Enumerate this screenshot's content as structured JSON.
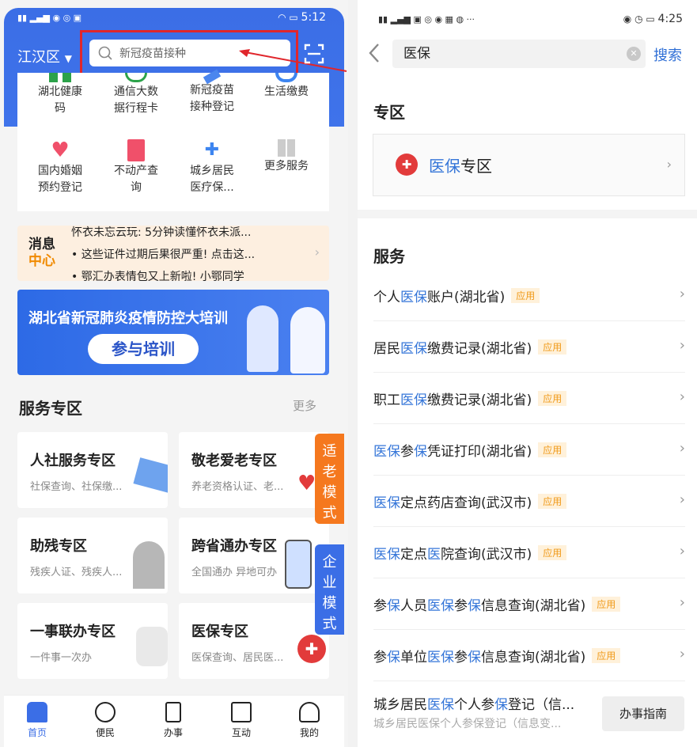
{
  "left": {
    "status": {
      "time": "5:12"
    },
    "city": "江汉区",
    "search": {
      "placeholder": "新冠疫苗接种"
    },
    "grid": [
      {
        "l1": "湖北健康",
        "l2": "码"
      },
      {
        "l1": "通信大数",
        "l2": "据行程卡"
      },
      {
        "l1": "新冠疫苗",
        "l2": "接种登记"
      },
      {
        "l1": "生活缴费",
        "l2": ""
      },
      {
        "l1": "国内婚姻",
        "l2": "预约登记"
      },
      {
        "l1": "不动产查",
        "l2": "询"
      },
      {
        "l1": "城乡居民",
        "l2": "医疗保..."
      },
      {
        "l1": "更多服务",
        "l2": ""
      }
    ],
    "msg": {
      "tag1": "消息",
      "tag2": "中心",
      "lines": [
        "怀衣未忘云玩: 5分钟读懂怀衣未派...",
        "• 这些证件过期后果很严重! 点击这...",
        "• 鄂汇办表情包又上新啦! 小鄂同学"
      ]
    },
    "banner": {
      "title": "湖北省新冠肺炎疫情防控大培训",
      "button": "参与培训"
    },
    "section": {
      "title": "服务专区",
      "more": "更多"
    },
    "tiles": [
      {
        "title": "人社服务专区",
        "sub": "社保查询、社保缴..."
      },
      {
        "title": "敬老爱老专区",
        "sub": "养老资格认证、老..."
      },
      {
        "title": "助残专区",
        "sub": "残疾人证、残疾人..."
      },
      {
        "title": "跨省通办专区",
        "sub": "全国通办  异地可办"
      },
      {
        "title": "一事联办专区",
        "sub": "一件事一次办"
      },
      {
        "title": "医保专区",
        "sub": "医保查询、居民医..."
      }
    ],
    "side_tabs": [
      "适老模式",
      "企业模式"
    ],
    "nav": [
      "首页",
      "便民",
      "办事",
      "互动",
      "我的"
    ]
  },
  "right": {
    "status": {
      "time": "4:25"
    },
    "search": {
      "value": "医保",
      "button": "搜索"
    },
    "zone": {
      "title": "专区",
      "item_hl": "医保",
      "item_rest": "专区"
    },
    "services": {
      "title": "服务",
      "badge": "应用",
      "rows": [
        [
          [
            "个人",
            0
          ],
          [
            "医保",
            1
          ],
          [
            "账户(湖北省)",
            0
          ]
        ],
        [
          [
            "居民",
            0
          ],
          [
            "医保",
            1
          ],
          [
            "缴费记录(湖北省)",
            0
          ]
        ],
        [
          [
            "职工",
            0
          ],
          [
            "医保",
            1
          ],
          [
            "缴费记录(湖北省)",
            0
          ]
        ],
        [
          [
            "医保",
            1
          ],
          [
            "参",
            0
          ],
          [
            "保",
            1
          ],
          [
            "凭证打印(湖北省)",
            0
          ]
        ],
        [
          [
            "医保",
            1
          ],
          [
            "定点药店查询(武汉市)",
            0
          ]
        ],
        [
          [
            "医保",
            1
          ],
          [
            "定点",
            0
          ],
          [
            "医",
            1
          ],
          [
            "院查询(武汉市)",
            0
          ]
        ],
        [
          [
            "参",
            0
          ],
          [
            "保",
            1
          ],
          [
            "人员",
            0
          ],
          [
            "医保",
            1
          ],
          [
            "参",
            0
          ],
          [
            "保",
            1
          ],
          [
            "信息查询(湖北省)",
            0
          ]
        ],
        [
          [
            "参",
            0
          ],
          [
            "保",
            1
          ],
          [
            "单位",
            0
          ],
          [
            "医保",
            1
          ],
          [
            "参",
            0
          ],
          [
            "保",
            1
          ],
          [
            "信息查询(湖北省)",
            0
          ]
        ]
      ],
      "last": {
        "title_parts": [
          [
            "城乡居民",
            0
          ],
          [
            "医保",
            1
          ],
          [
            "个人参",
            0
          ],
          [
            "保",
            1
          ],
          [
            "登记（信...",
            0
          ]
        ],
        "sub": "城乡居民医保个人参保登记（信息变...",
        "button": "办事指南"
      }
    }
  },
  "colors": {
    "brand": "#3b6ee6",
    "highlight": "#3475d8",
    "badge": "#f09a1a",
    "annotation": "#e0262c"
  }
}
